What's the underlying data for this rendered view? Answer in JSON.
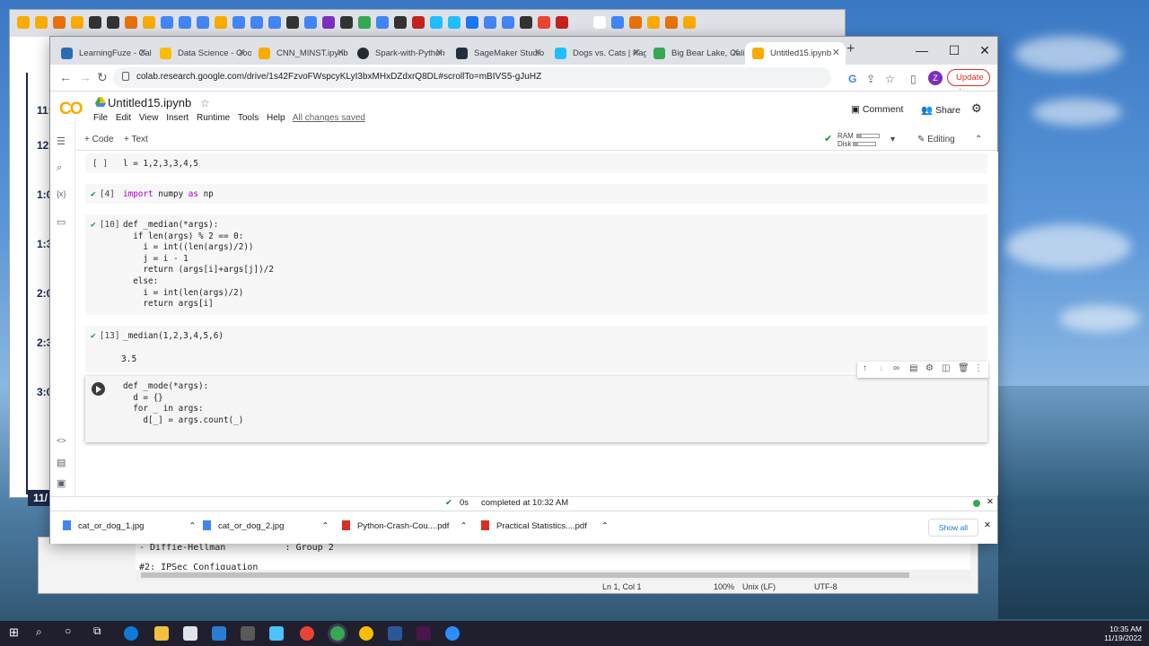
{
  "background_window": {
    "sidebar_labels": [
      "11:",
      "12:",
      "1:0",
      "1:3",
      "2:0",
      "2:3",
      "3:0",
      "11/"
    ]
  },
  "notepad": {
    "line1": "- Diffie-Hellman           : Group 2",
    "line2": "#2: IPSec Configuation",
    "status": {
      "pos": "Ln 1, Col 1",
      "zoom": "100%",
      "eol": "Unix (LF)",
      "enc": "UTF-8"
    }
  },
  "chrome": {
    "tabs": [
      {
        "title": "LearningFuze - Cal",
        "color": "#2b6cb0"
      },
      {
        "title": "Data Science - Goo",
        "color": "#fbbc04"
      },
      {
        "title": "CNN_MINST.ipynb",
        "color": "#f9ab00"
      },
      {
        "title": "Spark-with-Python",
        "color": "#24292f"
      },
      {
        "title": "SageMaker Studio",
        "color": "#232f3e"
      },
      {
        "title": "Dogs vs. Cats | Kag",
        "color": "#20beff"
      },
      {
        "title": "Big Bear Lake, Cali",
        "color": "#34a853"
      },
      {
        "title": "Untitled15.ipynb",
        "color": "#f9ab00"
      }
    ],
    "url": "colab.research.google.com/drive/1s42FzvoFWspcyKLyI3bxMHxDZdxrQ8DL#scrollTo=mBIVS5-gJuHZ",
    "avatar_letter": "Z",
    "update_label": "Update"
  },
  "colab": {
    "notebook_title": "Untitled15.ipynb",
    "menu": [
      "File",
      "Edit",
      "View",
      "Insert",
      "Runtime",
      "Tools",
      "Help"
    ],
    "saved_status": "All changes saved",
    "comment_label": "Comment",
    "share_label": "Share",
    "add_code": "+ Code",
    "add_text": "+ Text",
    "ram_label": "RAM",
    "disk_label": "Disk",
    "editing_label": "Editing",
    "cells": [
      {
        "exec": "[ ]",
        "code": "l = 1,2,3,3,4,5"
      },
      {
        "exec": "[4]",
        "code": "import numpy as np"
      },
      {
        "exec": "[10]",
        "code": "def _median(*args):\n  if len(args) % 2 == 0:\n    i = int((len(args)/2))\n    j = i - 1\n    return (args[i]+args[j])/2\n  else:\n    i = int(len(args)/2)\n    return args[i]"
      },
      {
        "exec": "[13]",
        "code": "_median(1,2,3,4,5,6)",
        "output": "3.5"
      },
      {
        "exec": "",
        "code": "def _mode(*args):\n  d = {}\n  for _ in args:\n    d[_] = args.count(_)\n  "
      }
    ],
    "exec_time": "0s",
    "status_text": "0s",
    "completed_text": "completed at 10:32 AM"
  },
  "downloads": {
    "items": [
      "cat_or_dog_1.jpg",
      "cat_or_dog_2.jpg",
      "Python-Crash-Cou....pdf",
      "Practical Statistics....pdf"
    ],
    "show_all": "Show all"
  },
  "taskbar": {
    "time": "10:35 AM",
    "date": "11/19/2022"
  }
}
